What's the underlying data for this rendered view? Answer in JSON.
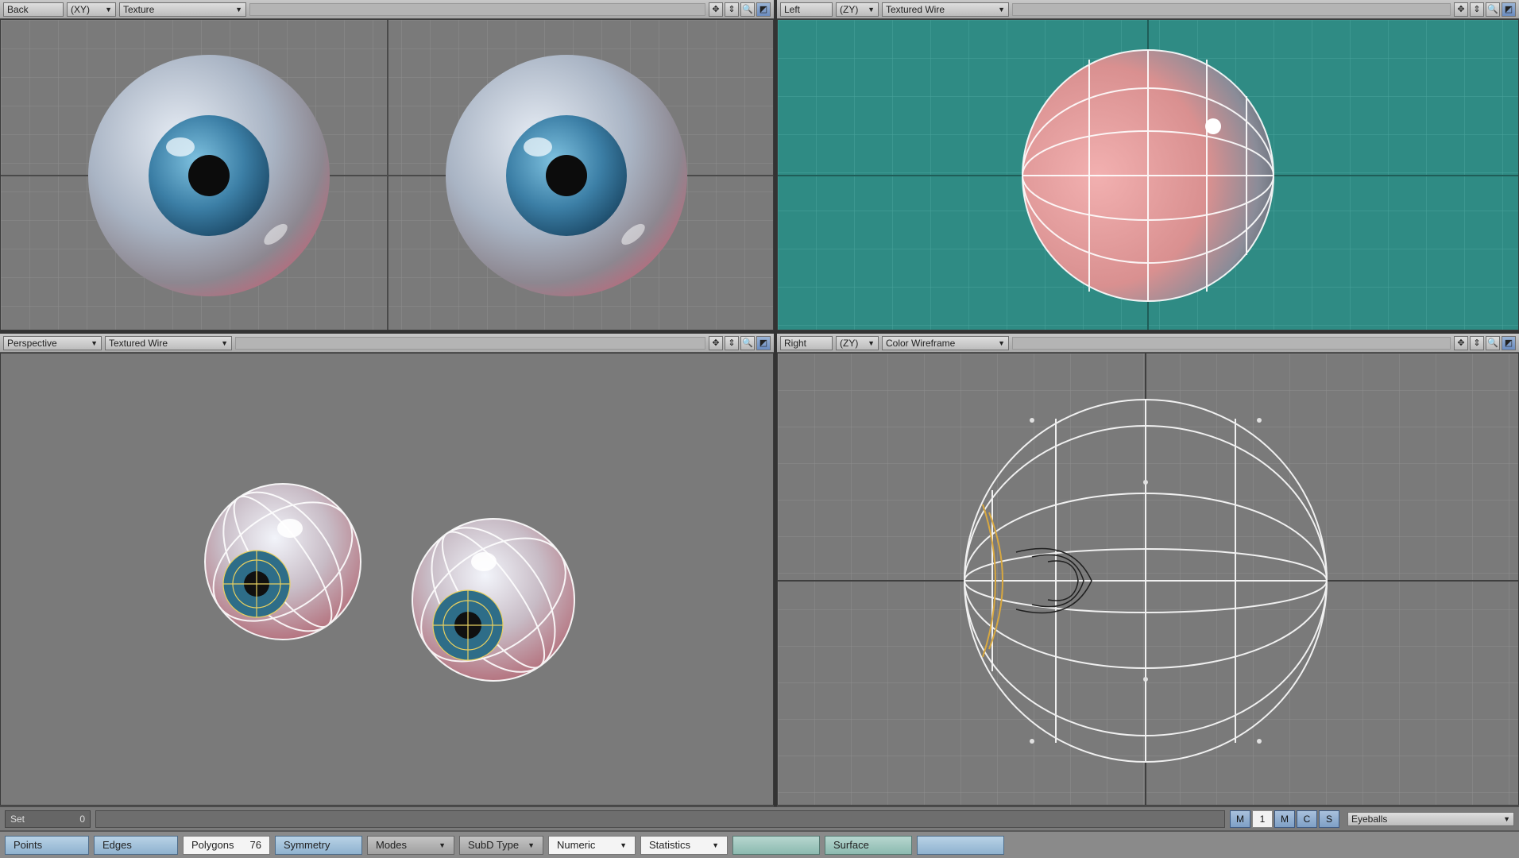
{
  "viewports": {
    "top_left": {
      "view": "Back",
      "zoom": "(XY)",
      "render_mode": "Texture"
    },
    "top_right": {
      "view": "Left",
      "zoom": "(ZY)",
      "render_mode": "Textured Wire"
    },
    "bottom_left": {
      "view": "Perspective",
      "render_mode": "Textured Wire"
    },
    "bottom_right": {
      "view": "Right",
      "zoom": "(ZY)",
      "render_mode": "Color Wireframe"
    }
  },
  "viewport_buttons": [
    "✥",
    "⇕",
    "🔍",
    "◩"
  ],
  "status_bar": {
    "set_label": "Set",
    "set_value": "0",
    "layer_buttons": [
      "M",
      "1",
      "M",
      "C",
      "S"
    ],
    "object_name": "Eyeballs"
  },
  "mode_bar": {
    "points": "Points",
    "edges": "Edges",
    "polygons": "Polygons",
    "polygons_count": "76",
    "symmetry": "Symmetry",
    "modes": "Modes",
    "subd_type": "SubD Type",
    "numeric": "Numeric",
    "statistics": "Statistics",
    "info": "",
    "surface": "Surface",
    "vmap": ""
  },
  "colors": {
    "viewport_bg": "#7a7a7a",
    "selected_viewport_bg": "#2f8b84",
    "grid_line": "#8e8e8e",
    "axis_line": "#4a4a4a",
    "button_blue": "#8fb2cf",
    "iris": "#3c7fa6"
  }
}
